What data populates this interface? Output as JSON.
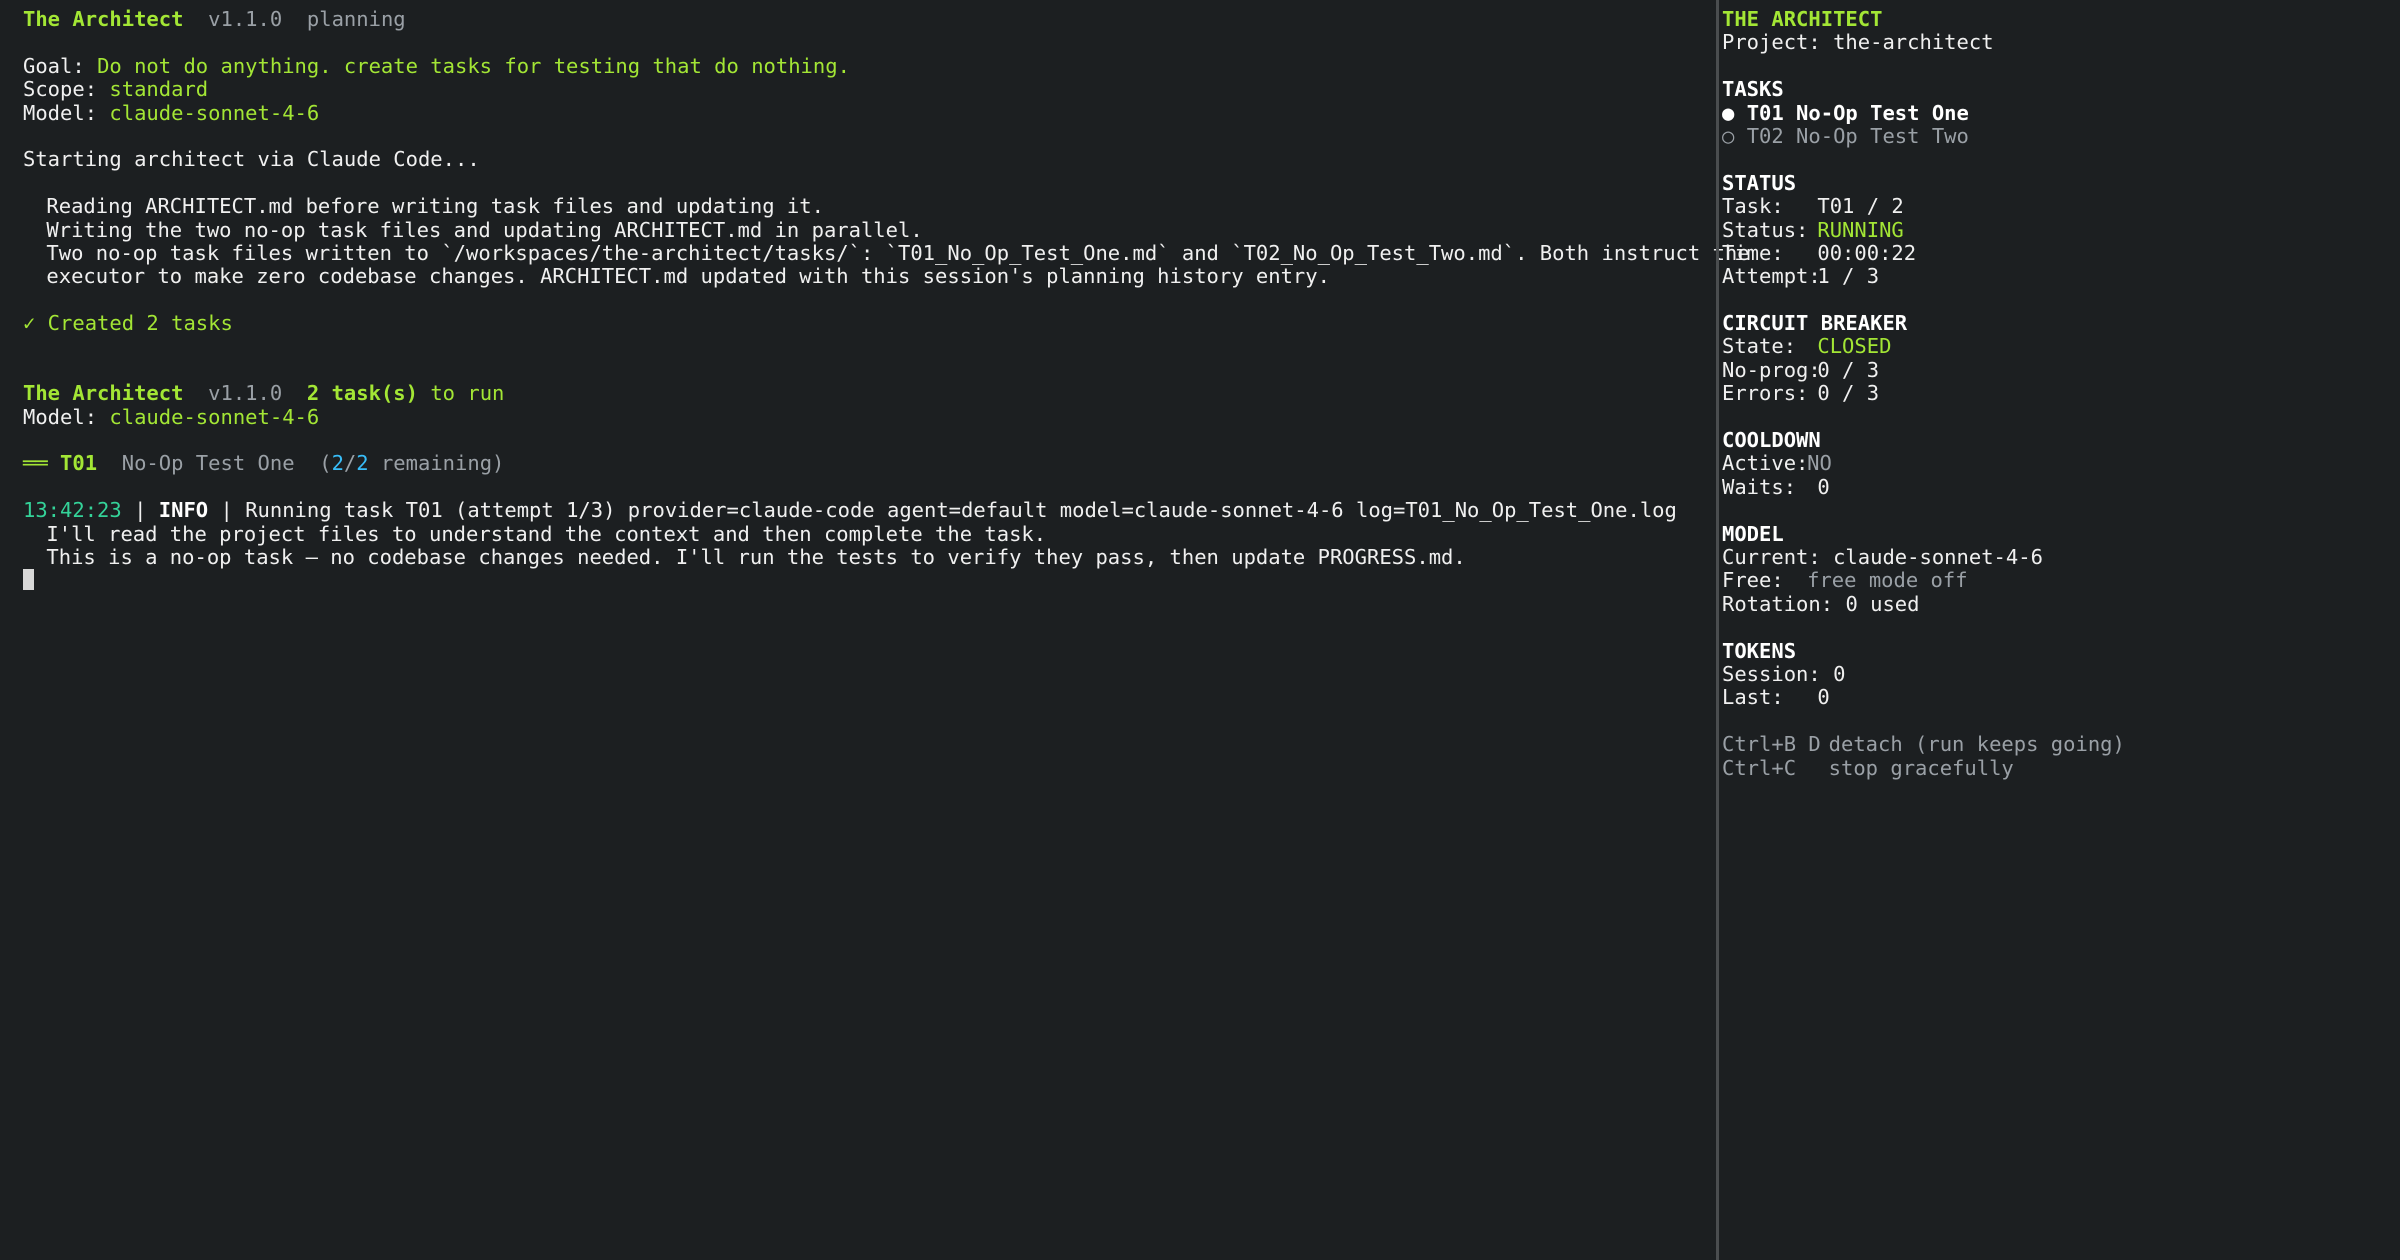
{
  "colors": {
    "background": "#1c1f21",
    "accent_green": "#a3e635",
    "timestamp_teal": "#34d399",
    "count_cyan": "#38bdf8",
    "dim_gray": "#9aa0a6",
    "divider": "#4a4d4f"
  },
  "left": {
    "header1": {
      "app_name": "The Architect",
      "version": "v1.1.0",
      "mode": "planning"
    },
    "goal": {
      "label": "Goal:",
      "value": "Do not do anything. create tasks for testing that do nothing."
    },
    "scope": {
      "label": "Scope:",
      "value": "standard"
    },
    "model": {
      "label": "Model:",
      "value": "claude-sonnet-4-6"
    },
    "starting": "Starting architect via Claude Code...",
    "arch_lines": [
      "Reading ARCHITECT.md before writing task files and updating it.",
      "Writing the two no-op task files and updating ARCHITECT.md in parallel.",
      "Two no-op task files written to `/workspaces/the-architect/tasks/`: `T01_No_Op_Test_One.md` and `T02_No_Op_Test_Two.md`. Both instruct the",
      "executor to make zero codebase changes. ARCHITECT.md updated with this session's planning history entry."
    ],
    "created": "✓ Created 2 tasks",
    "header2": {
      "app_name": "The Architect",
      "version": "v1.1.0",
      "count": "2 task(s)",
      "suffix": "to run"
    },
    "model2": {
      "label": "Model:",
      "value": "claude-sonnet-4-6"
    },
    "task_header": {
      "bar": "══",
      "id": "T01",
      "name": "No-Op Test One",
      "open": "(",
      "num": "2",
      "slash": "/",
      "den": "2",
      "rest": " remaining)"
    },
    "log": {
      "timestamp": "13:42:23",
      "sep1": " | ",
      "level": "INFO",
      "sep2": " | ",
      "message": "Running task T01 (attempt 1/3) provider=claude-code agent=default model=claude-sonnet-4-6 log=T01_No_Op_Test_One.log"
    },
    "agent_lines": [
      "I'll read the project files to understand the context and then complete the task.",
      "This is a no-op task — no codebase changes needed. I'll run the tests to verify they pass, then update PROGRESS.md."
    ]
  },
  "right": {
    "title": "THE ARCHITECT",
    "project": {
      "label": "Project:",
      "value": "the-architect"
    },
    "tasks_heading": "TASKS",
    "tasks": [
      {
        "bullet": "●",
        "label": "T01 No-Op Test One"
      },
      {
        "bullet": "○",
        "label": "T02 No-Op Test Two"
      }
    ],
    "status_heading": "STATUS",
    "status": {
      "task_label": "Task:",
      "task_value": "T01 / 2",
      "status_label": "Status:",
      "status_value": "RUNNING",
      "time_label": "Time:",
      "time_value": "00:00:22",
      "attempt_label": "Attempt:",
      "attempt_value": "1 / 3"
    },
    "breaker_heading": "CIRCUIT BREAKER",
    "breaker": {
      "state_label": "State:",
      "state_value": "CLOSED",
      "noprog_label": "No-prog:",
      "noprog_value": "0 / 3",
      "errors_label": "Errors:",
      "errors_value": "0 / 3"
    },
    "cooldown_heading": "COOLDOWN",
    "cooldown": {
      "active_label": "Active:",
      "active_value": "NO",
      "waits_label": "Waits:",
      "waits_value": "0"
    },
    "model_heading": "MODEL",
    "model": {
      "current_label": "Current:",
      "current_value": "claude-sonnet-4-6",
      "free_label": "Free:",
      "free_value": "free mode off",
      "rotation_label": "Rotation:",
      "rotation_value": "0 used"
    },
    "tokens_heading": "TOKENS",
    "tokens": {
      "session_label": "Session:",
      "session_value": "0",
      "last_label": "Last:",
      "last_value": "0"
    },
    "shortcuts": [
      {
        "keys": "Ctrl+B D",
        "desc": "detach (run keeps going)"
      },
      {
        "keys": "Ctrl+C",
        "desc": "stop gracefully"
      }
    ]
  }
}
